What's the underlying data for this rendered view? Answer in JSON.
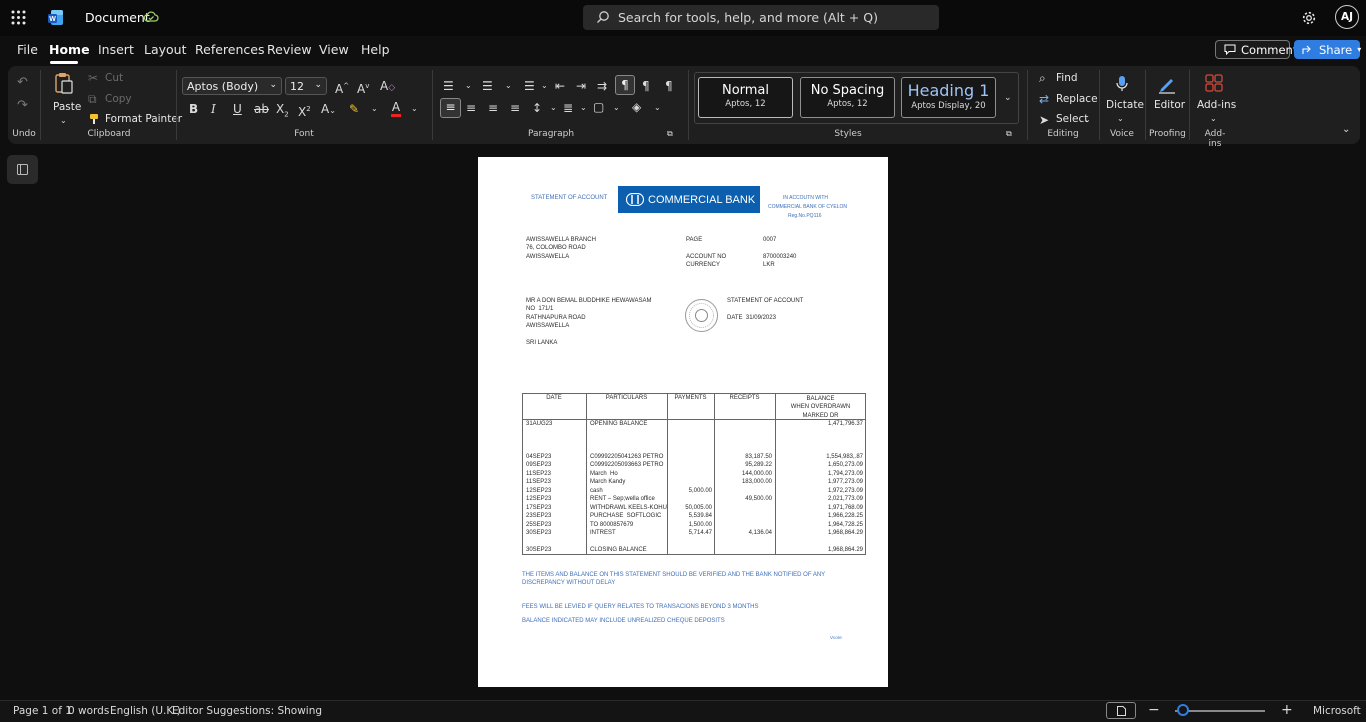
{
  "titlebar": {
    "app_name": "Document",
    "search_placeholder": "Search for tools, help, and more (Alt + Q)",
    "avatar_initials": "AJ"
  },
  "menu": {
    "items": [
      "File",
      "Home",
      "Insert",
      "Layout",
      "References",
      "Review",
      "View",
      "Help"
    ],
    "active": "Home",
    "comments_label": "Comments",
    "share_label": "Share"
  },
  "ribbon": {
    "undo_group": "Undo",
    "clipboard": {
      "paste": "Paste",
      "cut": "Cut",
      "copy": "Copy",
      "format_painter": "Format Painter",
      "label": "Clipboard"
    },
    "font": {
      "name": "Aptos (Body)",
      "size": "12",
      "label": "Font"
    },
    "paragraph": {
      "label": "Paragraph"
    },
    "styles": {
      "label": "Styles",
      "items": [
        {
          "name": "Normal",
          "sub": "Aptos, 12"
        },
        {
          "name": "No Spacing",
          "sub": "Aptos, 12"
        },
        {
          "name": "Heading 1",
          "sub": "Aptos Display, 20"
        }
      ]
    },
    "editing": {
      "find": "Find",
      "replace": "Replace",
      "select": "Select",
      "label": "Editing"
    },
    "voice": {
      "dictate": "Dictate",
      "label": "Voice"
    },
    "proofing": {
      "editor": "Editor",
      "label": "Proofing"
    },
    "addins": {
      "addins": "Add-ins",
      "label": "Add-ins"
    }
  },
  "document": {
    "header_left": "STATEMENT OF ACCOUNT",
    "bank_logo": "COMMERCIAL BANK",
    "header_right": [
      "IN ACCOUTN WITH",
      "COMMERCIAL BANK OF CYELON",
      "Reg.No.PQ116"
    ],
    "branch": [
      "AWISSAWELLA BRANCH",
      "76, COLOMBO ROAD",
      "AWISSAWELLA"
    ],
    "meta_labels": [
      "PAGE",
      "",
      "ACCOUNT NO",
      "CURRENCY"
    ],
    "meta_values": [
      "0007",
      "",
      "8700003240",
      "LKR"
    ],
    "customer": [
      "MR A DON BEMAL BUDDHIKE HEWAWASAM",
      "NO  171/1",
      "RATHNAPURA ROAD",
      "AWISSAWELLA",
      "",
      "SRI LANKA"
    ],
    "statement_title": "STATEMENT OF ACCOUNT",
    "statement_date": "DATE  31/09/2023",
    "table": {
      "headers": [
        "DATE",
        "PARTICULARS",
        "PAYMENTS",
        "RECEIPTS",
        "BALANCE\nWHEN OVERDRAWN\nMARKED DR"
      ],
      "opening": [
        "31AUG23",
        "OPENING BALANCE",
        "",
        "",
        "1,471,796.37"
      ],
      "rows": [
        [
          "04SEP23",
          "C09992205041263 PETRO",
          "",
          "83,187.50",
          "1,554,983,.87"
        ],
        [
          "09SEP23",
          "C09992205093663 PETRO",
          "",
          "95,289.22",
          "1,650,273.09"
        ],
        [
          "11SEP23",
          "March  Ho",
          "",
          "144,000.00",
          "1,794,273.09"
        ],
        [
          "11SEP23",
          "March Kandy",
          "",
          "183,000.00",
          "1,977,273.09"
        ],
        [
          "12SEP23",
          "cash",
          "5,000.00",
          "",
          "1,972,273.09"
        ],
        [
          "12SEP23",
          "RENT – Sep;wella office",
          "",
          "49,500.00",
          "2,021,773.09"
        ],
        [
          "17SEP23",
          "WITHDRAWL KEELS-KOHU",
          "50,005.00",
          "",
          "1,971,768.09"
        ],
        [
          "23SEP23",
          "PURCHASE  SOFTLOGIC",
          "5,539.84",
          "",
          "1,966,228.25"
        ],
        [
          "25SEP23",
          "TO 8000857679",
          "1,500.00",
          "",
          "1,964,728.25"
        ],
        [
          "30SEP23",
          "INTREST",
          "5,714.47",
          "4,136.04",
          "1,968,864.29"
        ]
      ],
      "closing": [
        "30SEP23",
        "CLOSING BALANCE",
        "",
        "",
        "1,968,864.29"
      ]
    },
    "notes": [
      "THE ITEMS AND BALANCE ON THIS STATEMENT SHOULD BE VERIFIED AND THE BANK NOTIFIED OF ANY",
      "DISCREPANCY WITHOUT DELAY",
      "FEES WILL BE LEVIED IF QUERY RELATES TO TRANSACIONS BEYOND 3 MONTHS",
      "BALANCE INDICATED MAY INCLUDE UNREALIZED CHEQUE DEPOSITS"
    ],
    "footer_mark": "Vcore"
  },
  "statusbar": {
    "page": "Page 1 of 1",
    "words": "0 words",
    "language": "English (U.K.)",
    "editor": "Editor Suggestions: Showing",
    "brand": "Microsoft"
  },
  "colors": {
    "accent": "#2f7de1",
    "bank_blue": "#0b5fae",
    "doc_blue_text": "#3f6fb8"
  }
}
